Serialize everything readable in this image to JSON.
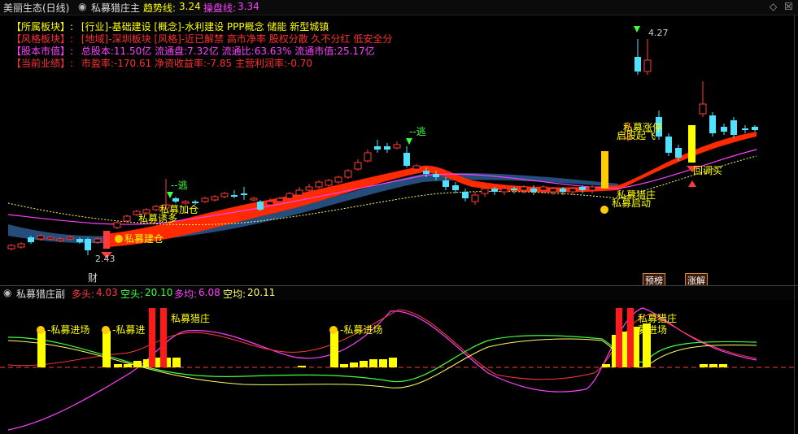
{
  "header": {
    "stock_name": "美丽生态(日线)",
    "indicator_name": "私募猎庄主",
    "trend_label": "趋势线:",
    "trend_value": "3.24",
    "control_label": "操盘线:",
    "control_value": "3.34",
    "diamond_icon": "diamond-icon",
    "close_icon": "close-icon"
  },
  "info": {
    "sector_label": "【所属板块】:",
    "sector_value": "[行业]-基础建设 [概念]-水利建设 PPP概念 储能 新型城镇",
    "style_label": "【风格板块】:",
    "style_value": "[地域]-深圳板块 [风格]-近已解禁 高市净率 股权分散 久不分红 低安全分",
    "market_label": "【股本市值】:",
    "market_value": "总股本:11.50亿 流通盘:7.32亿 流通比:63.63% 流通市值:25.17亿",
    "perf_label": "【当前业绩】:",
    "perf_value": "市盈率:-170.61 净资收益率:-7.85 主营利润率:-0.70"
  },
  "main_chart": {
    "price_high": "4.27",
    "price_low": "2.43",
    "signal_escape_1": "--逃",
    "signal_escape_2": "--逃",
    "signal_build": "私募建仓",
    "signal_add": "私募加仓",
    "signal_lure": "私募诱多",
    "signal_hunt": "私募猎庄",
    "signal_start": "私募启动",
    "signal_rise": "私募涨停",
    "signal_firststart": "启股起飞",
    "signal_adjust": "回调买",
    "marker_cai": "财",
    "badge_forecast": "预榜",
    "badge_limit": "涨解"
  },
  "sub_panel": {
    "title": "私募猎庄副",
    "long_label": "多头:",
    "long_value": "4.03",
    "short_label": "空头:",
    "short_value": "20.10",
    "long_avg_label": "多均:",
    "long_avg_value": "6.08",
    "short_avg_label": "空均:",
    "short_avg_value": "20.11",
    "enter_1": "-私募进场",
    "enter_2": "-私募进",
    "enter_3": "-私募进场",
    "enter_4": "募进场",
    "hunt_1": "私募猎庄",
    "hunt_2": "私募猎庄"
  },
  "colors": {
    "up": "#ff3b3b",
    "down": "#52e0ff",
    "yellow": "#ffff00",
    "magenta": "#ff40ff",
    "green": "#40ff40",
    "red_band": "#ff2a00",
    "blue_band": "#3a6aa0"
  }
}
